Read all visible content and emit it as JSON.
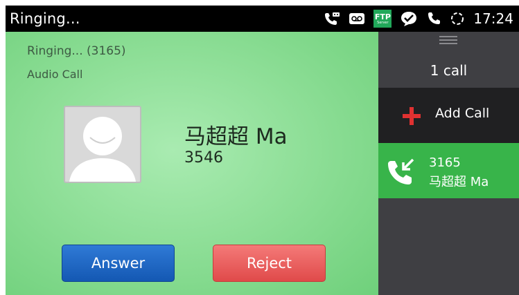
{
  "statusbar": {
    "title": "Ringing...",
    "time": "17:24",
    "ftp_label": "FTP",
    "ftp_sublabel": "Server",
    "icons": [
      "voicemail-phone-icon",
      "voicemail-icon",
      "ftp-server-icon",
      "check-chat-icon",
      "phone-icon",
      "sync-icon"
    ]
  },
  "call": {
    "ringing_label": "Ringing... (3165)",
    "call_type": "Audio Call",
    "contact_name": "马超超 Ma",
    "contact_number": "3546"
  },
  "buttons": {
    "answer": "Answer",
    "reject": "Reject"
  },
  "colors": {
    "answer": "#1d64c0",
    "reject": "#ec5e5e",
    "active_call": "#38b44a",
    "add_call_icon": "#e03131"
  },
  "side": {
    "call_count": "1 call",
    "add_call": "Add Call",
    "active_call": {
      "number": "3165",
      "name": "马超超 Ma"
    }
  }
}
